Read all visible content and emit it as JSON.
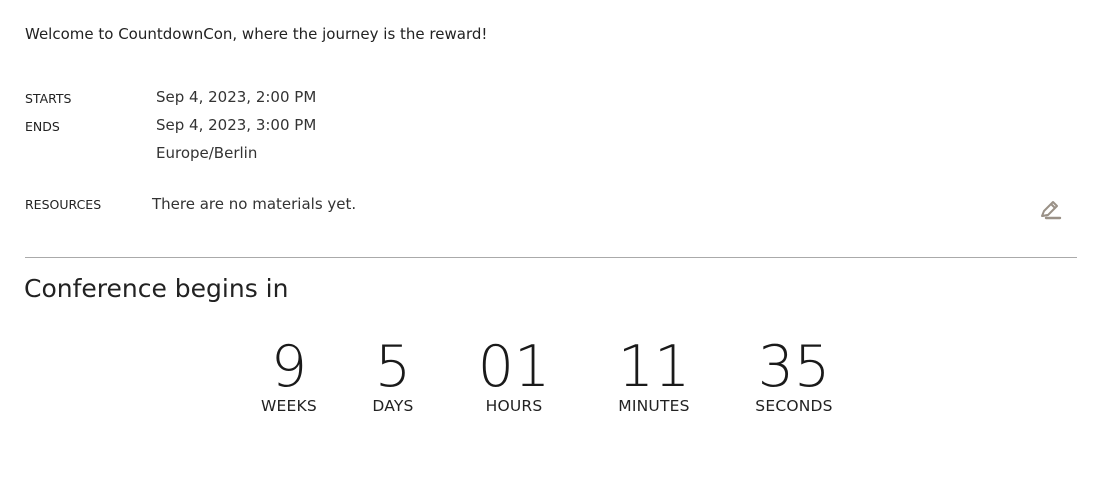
{
  "welcome_text": "Welcome to CountdownCon, where the journey is the reward!",
  "details": {
    "starts_label": "STARTS",
    "starts_value": "Sep 4, 2023, 2:00 PM",
    "ends_label": "ENDS",
    "ends_value": "Sep 4, 2023, 3:00 PM",
    "timezone": "Europe/Berlin",
    "resources_label": "RESOURCES",
    "resources_value": "There are no materials yet.",
    "edit_icon": "pencil-icon",
    "edit_icon_color": "#9a9187"
  },
  "countdown": {
    "title": "Conference begins in",
    "units": [
      {
        "value": "9",
        "label": "WEEKS"
      },
      {
        "value": "5",
        "label": "DAYS"
      },
      {
        "value": "01",
        "label": "HOURS"
      },
      {
        "value": "11",
        "label": "MINUTES"
      },
      {
        "value": "35",
        "label": "SECONDS"
      }
    ]
  }
}
